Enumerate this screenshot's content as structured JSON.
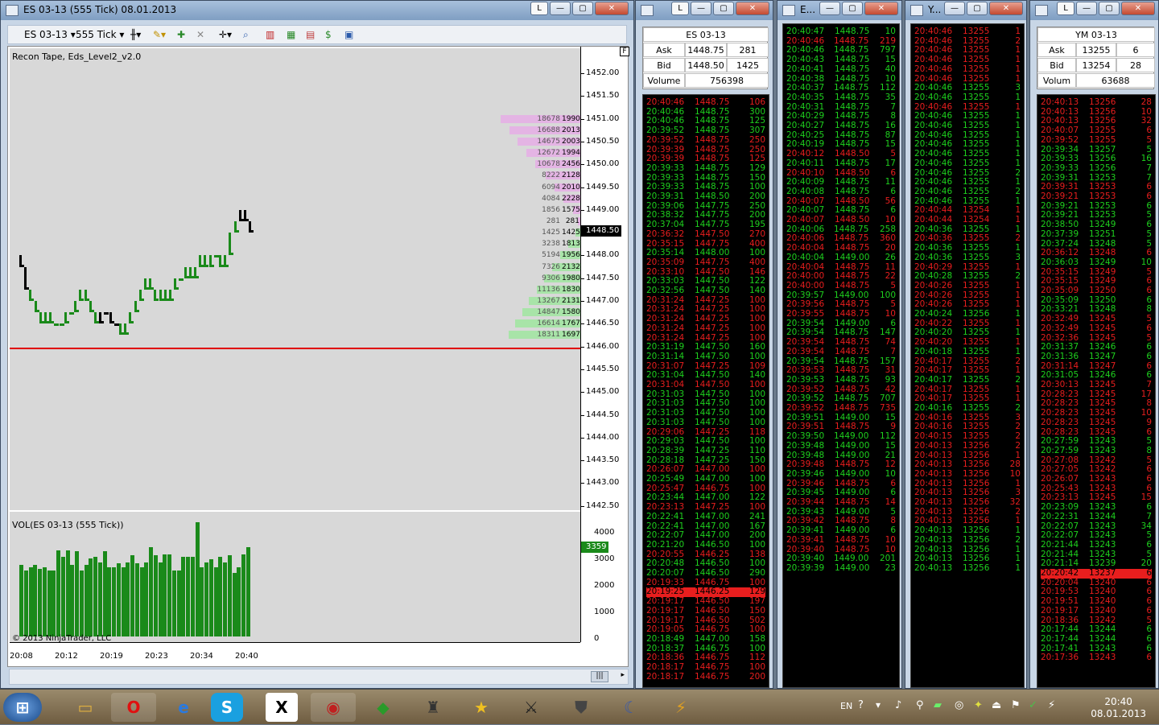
{
  "chart_window": {
    "title": "ES 03-13 (555 Tick)  08.01.2013",
    "instrument": "ES 03-13",
    "interval": "555 Tick",
    "indicator_label": "Recon Tape, Eds_Level2_v2.0",
    "copyright": "© 2013 NinjaTrader, LLC",
    "vol_label": "VOL(ES 03-13 (555 Tick))",
    "last_price": "1448.50",
    "last_vol": "3359",
    "corner_box": "F"
  },
  "price_axis": [
    "1452.00",
    "1451.50",
    "1451.00",
    "1450.50",
    "1450.00",
    "1449.50",
    "1449.00",
    "1448.50",
    "1448.00",
    "1447.50",
    "1447.00",
    "1446.50",
    "1446.00",
    "1445.50",
    "1445.00",
    "1444.50",
    "1444.00",
    "1443.50",
    "1443.00",
    "1442.50"
  ],
  "vol_axis": [
    "4000",
    "3000",
    "2000",
    "1000",
    "0"
  ],
  "time_axis": [
    "20:08",
    "20:12",
    "20:19",
    "20:23",
    "20:34",
    "20:40"
  ],
  "dom_ask": [
    [
      "18678",
      "1990"
    ],
    [
      "16688",
      "2013"
    ],
    [
      "14675",
      "2003"
    ],
    [
      "12672",
      "1994"
    ],
    [
      "10678",
      "2456"
    ],
    [
      "8222",
      "2128"
    ],
    [
      "6094",
      "2010"
    ],
    [
      "4084",
      "2228"
    ],
    [
      "1856",
      "1575"
    ],
    [
      "281",
      "281"
    ]
  ],
  "dom_bid": [
    [
      "1425",
      "1425"
    ],
    [
      "3238",
      "1813"
    ],
    [
      "5194",
      "1956"
    ],
    [
      "7326",
      "2132"
    ],
    [
      "9306",
      "1980"
    ],
    [
      "11136",
      "1830"
    ],
    [
      "13267",
      "2131"
    ],
    [
      "14847",
      "1580"
    ],
    [
      "16614",
      "1767"
    ],
    [
      "18311",
      "1697"
    ]
  ],
  "chart_data": {
    "type": "bar",
    "title": "",
    "xlabel": "",
    "ylabel": "",
    "ylim": [
      0,
      4600
    ],
    "values": [
      2700,
      2500,
      2600,
      2700,
      2550,
      2600,
      2500,
      2500,
      3250,
      3000,
      3250,
      2700,
      3200,
      2500,
      2700,
      2950,
      3000,
      2800,
      3200,
      2600,
      2600,
      2750,
      2600,
      2800,
      3050,
      2750,
      2600,
      2800,
      3350,
      3050,
      2800,
      3100,
      3100,
      2500,
      2500,
      3000,
      3000,
      3000,
      4300,
      2600,
      2800,
      2900,
      2600,
      3000,
      2800,
      3050,
      2400,
      2600,
      3100,
      3359
    ]
  },
  "quote_es": {
    "title": "ES 03-13",
    "ask_label": "Ask",
    "ask": "1448.75",
    "ask_size": "281",
    "bid_label": "Bid",
    "bid": "1448.50",
    "bid_size": "1425",
    "vol_label": "Volume",
    "vol": "756398"
  },
  "quote_ym": {
    "title": "YM 03-13",
    "ask_label": "Ask",
    "ask": "13255",
    "ask_size": "6",
    "bid_label": "Bid",
    "bid": "13254",
    "bid_size": "28",
    "vol_label": "Volum",
    "vol": "63688"
  },
  "tape1": [
    [
      "20:40:46",
      "1448.75",
      "106",
      "r"
    ],
    [
      "20:40:46",
      "1448.75",
      "300",
      "g"
    ],
    [
      "20:40:46",
      "1448.75",
      "125",
      "g"
    ],
    [
      "20:39:52",
      "1448.75",
      "307",
      "g"
    ],
    [
      "20:39:52",
      "1448.75",
      "250",
      "r"
    ],
    [
      "20:39:39",
      "1448.75",
      "250",
      "r"
    ],
    [
      "20:39:39",
      "1448.75",
      "125",
      "r"
    ],
    [
      "20:39:33",
      "1448.75",
      "129",
      "g"
    ],
    [
      "20:39:33",
      "1448.75",
      "150",
      "g"
    ],
    [
      "20:39:33",
      "1448.75",
      "100",
      "g"
    ],
    [
      "20:39:31",
      "1448.50",
      "200",
      "g"
    ],
    [
      "20:39:06",
      "1447.75",
      "250",
      "g"
    ],
    [
      "20:38:32",
      "1447.75",
      "200",
      "g"
    ],
    [
      "20:37:04",
      "1447.75",
      "195",
      "g"
    ],
    [
      "20:36:32",
      "1447.50",
      "270",
      "r"
    ],
    [
      "20:35:15",
      "1447.75",
      "400",
      "r"
    ],
    [
      "20:35:14",
      "1448.00",
      "100",
      "g"
    ],
    [
      "20:35:09",
      "1447.75",
      "400",
      "r"
    ],
    [
      "20:33:10",
      "1447.50",
      "146",
      "r"
    ],
    [
      "20:33:03",
      "1447.50",
      "122",
      "g"
    ],
    [
      "20:32:56",
      "1447.50",
      "140",
      "g"
    ],
    [
      "20:31:24",
      "1447.25",
      "100",
      "r"
    ],
    [
      "20:31:24",
      "1447.25",
      "100",
      "r"
    ],
    [
      "20:31:24",
      "1447.25",
      "100",
      "r"
    ],
    [
      "20:31:24",
      "1447.25",
      "100",
      "r"
    ],
    [
      "20:31:24",
      "1447.25",
      "100",
      "r"
    ],
    [
      "20:31:19",
      "1447.50",
      "160",
      "g"
    ],
    [
      "20:31:14",
      "1447.50",
      "100",
      "g"
    ],
    [
      "20:31:07",
      "1447.25",
      "109",
      "r"
    ],
    [
      "20:31:04",
      "1447.50",
      "140",
      "g"
    ],
    [
      "20:31:04",
      "1447.50",
      "100",
      "r"
    ],
    [
      "20:31:03",
      "1447.50",
      "100",
      "g"
    ],
    [
      "20:31:03",
      "1447.50",
      "100",
      "g"
    ],
    [
      "20:31:03",
      "1447.50",
      "100",
      "g"
    ],
    [
      "20:31:03",
      "1447.50",
      "100",
      "g"
    ],
    [
      "20:29:06",
      "1447.25",
      "118",
      "r"
    ],
    [
      "20:29:03",
      "1447.50",
      "100",
      "g"
    ],
    [
      "20:28:39",
      "1447.25",
      "110",
      "g"
    ],
    [
      "20:28:18",
      "1447.25",
      "150",
      "g"
    ],
    [
      "20:26:07",
      "1447.00",
      "100",
      "r"
    ],
    [
      "20:25:49",
      "1447.00",
      "100",
      "g"
    ],
    [
      "20:25:47",
      "1446.75",
      "100",
      "r"
    ],
    [
      "20:23:44",
      "1447.00",
      "122",
      "g"
    ],
    [
      "20:23:13",
      "1447.25",
      "100",
      "r"
    ],
    [
      "20:22:41",
      "1447.00",
      "241",
      "g"
    ],
    [
      "20:22:41",
      "1447.00",
      "167",
      "g"
    ],
    [
      "20:22:07",
      "1447.00",
      "200",
      "g"
    ],
    [
      "20:21:20",
      "1446.50",
      "100",
      "g"
    ],
    [
      "20:20:55",
      "1446.25",
      "138",
      "r"
    ],
    [
      "20:20:48",
      "1446.50",
      "100",
      "g"
    ],
    [
      "20:20:07",
      "1446.50",
      "290",
      "g"
    ],
    [
      "20:19:33",
      "1446.75",
      "100",
      "r"
    ],
    [
      "20:19:25",
      "1446.25",
      "129",
      "h"
    ],
    [
      "20:19:17",
      "1446.50",
      "197",
      "r"
    ],
    [
      "20:19:17",
      "1446.50",
      "150",
      "r"
    ],
    [
      "20:19:17",
      "1446.50",
      "502",
      "r"
    ],
    [
      "20:19:05",
      "1446.75",
      "100",
      "r"
    ],
    [
      "20:18:49",
      "1447.00",
      "158",
      "g"
    ],
    [
      "20:18:37",
      "1446.75",
      "100",
      "g"
    ],
    [
      "20:18:36",
      "1446.75",
      "112",
      "r"
    ],
    [
      "20:18:17",
      "1446.75",
      "100",
      "r"
    ],
    [
      "20:18:17",
      "1446.75",
      "200",
      "r"
    ]
  ],
  "tape2": [
    [
      "20:40:47",
      "1448.75",
      "10",
      "g"
    ],
    [
      "20:40:46",
      "1448.75",
      "219",
      "r"
    ],
    [
      "20:40:46",
      "1448.75",
      "797",
      "g"
    ],
    [
      "20:40:43",
      "1448.75",
      "15",
      "g"
    ],
    [
      "20:40:41",
      "1448.75",
      "40",
      "g"
    ],
    [
      "20:40:38",
      "1448.75",
      "10",
      "g"
    ],
    [
      "20:40:37",
      "1448.75",
      "112",
      "g"
    ],
    [
      "20:40:35",
      "1448.75",
      "35",
      "g"
    ],
    [
      "20:40:31",
      "1448.75",
      "7",
      "g"
    ],
    [
      "20:40:29",
      "1448.75",
      "8",
      "g"
    ],
    [
      "20:40:27",
      "1448.75",
      "16",
      "g"
    ],
    [
      "20:40:25",
      "1448.75",
      "87",
      "g"
    ],
    [
      "20:40:19",
      "1448.75",
      "15",
      "g"
    ],
    [
      "20:40:12",
      "1448.50",
      "5",
      "r"
    ],
    [
      "20:40:11",
      "1448.75",
      "17",
      "g"
    ],
    [
      "20:40:10",
      "1448.50",
      "6",
      "r"
    ],
    [
      "20:40:09",
      "1448.75",
      "11",
      "g"
    ],
    [
      "20:40:08",
      "1448.75",
      "6",
      "g"
    ],
    [
      "20:40:07",
      "1448.50",
      "56",
      "r"
    ],
    [
      "20:40:07",
      "1448.75",
      "6",
      "g"
    ],
    [
      "20:40:07",
      "1448.50",
      "10",
      "r"
    ],
    [
      "20:40:06",
      "1448.75",
      "258",
      "g"
    ],
    [
      "20:40:06",
      "1448.75",
      "360",
      "r"
    ],
    [
      "20:40:04",
      "1448.75",
      "20",
      "r"
    ],
    [
      "20:40:04",
      "1449.00",
      "26",
      "g"
    ],
    [
      "20:40:04",
      "1448.75",
      "11",
      "r"
    ],
    [
      "20:40:00",
      "1448.75",
      "22",
      "r"
    ],
    [
      "20:40:00",
      "1448.75",
      "5",
      "r"
    ],
    [
      "20:39:57",
      "1449.00",
      "100",
      "g"
    ],
    [
      "20:39:56",
      "1448.75",
      "5",
      "r"
    ],
    [
      "20:39:55",
      "1448.75",
      "10",
      "r"
    ],
    [
      "20:39:54",
      "1449.00",
      "6",
      "g"
    ],
    [
      "20:39:54",
      "1448.75",
      "147",
      "g"
    ],
    [
      "20:39:54",
      "1448.75",
      "74",
      "r"
    ],
    [
      "20:39:54",
      "1448.75",
      "7",
      "r"
    ],
    [
      "20:39:54",
      "1448.75",
      "157",
      "g"
    ],
    [
      "20:39:53",
      "1448.75",
      "31",
      "r"
    ],
    [
      "20:39:53",
      "1448.75",
      "93",
      "g"
    ],
    [
      "20:39:52",
      "1448.75",
      "42",
      "r"
    ],
    [
      "20:39:52",
      "1448.75",
      "707",
      "g"
    ],
    [
      "20:39:52",
      "1448.75",
      "735",
      "r"
    ],
    [
      "20:39:51",
      "1449.00",
      "15",
      "g"
    ],
    [
      "20:39:51",
      "1448.75",
      "9",
      "r"
    ],
    [
      "20:39:50",
      "1449.00",
      "112",
      "g"
    ],
    [
      "20:39:48",
      "1449.00",
      "15",
      "g"
    ],
    [
      "20:39:48",
      "1449.00",
      "21",
      "g"
    ],
    [
      "20:39:48",
      "1448.75",
      "12",
      "r"
    ],
    [
      "20:39:46",
      "1449.00",
      "10",
      "g"
    ],
    [
      "20:39:46",
      "1448.75",
      "6",
      "r"
    ],
    [
      "20:39:45",
      "1449.00",
      "6",
      "g"
    ],
    [
      "20:39:44",
      "1448.75",
      "14",
      "r"
    ],
    [
      "20:39:43",
      "1449.00",
      "5",
      "g"
    ],
    [
      "20:39:42",
      "1448.75",
      "8",
      "r"
    ],
    [
      "20:39:41",
      "1449.00",
      "6",
      "g"
    ],
    [
      "20:39:41",
      "1448.75",
      "10",
      "r"
    ],
    [
      "20:39:40",
      "1448.75",
      "10",
      "r"
    ],
    [
      "20:39:40",
      "1449.00",
      "201",
      "g"
    ],
    [
      "20:39:39",
      "1449.00",
      "23",
      "g"
    ]
  ],
  "tape3": [
    [
      "20:40:46",
      "13255",
      "1",
      "r"
    ],
    [
      "20:40:46",
      "13255",
      "2",
      "r"
    ],
    [
      "20:40:46",
      "13255",
      "1",
      "r"
    ],
    [
      "20:40:46",
      "13255",
      "1",
      "r"
    ],
    [
      "20:40:46",
      "13255",
      "1",
      "r"
    ],
    [
      "20:40:46",
      "13255",
      "1",
      "r"
    ],
    [
      "20:40:46",
      "13255",
      "3",
      "g"
    ],
    [
      "20:40:46",
      "13255",
      "1",
      "g"
    ],
    [
      "20:40:46",
      "13255",
      "1",
      "r"
    ],
    [
      "20:40:46",
      "13255",
      "1",
      "g"
    ],
    [
      "20:40:46",
      "13255",
      "1",
      "g"
    ],
    [
      "20:40:46",
      "13255",
      "1",
      "g"
    ],
    [
      "20:40:46",
      "13255",
      "1",
      "g"
    ],
    [
      "20:40:46",
      "13255",
      "1",
      "g"
    ],
    [
      "20:40:46",
      "13255",
      "1",
      "g"
    ],
    [
      "20:40:46",
      "13255",
      "2",
      "g"
    ],
    [
      "20:40:46",
      "13255",
      "1",
      "g"
    ],
    [
      "20:40:46",
      "13255",
      "2",
      "g"
    ],
    [
      "20:40:46",
      "13255",
      "1",
      "g"
    ],
    [
      "20:40:44",
      "13254",
      "1",
      "r"
    ],
    [
      "20:40:44",
      "13254",
      "1",
      "r"
    ],
    [
      "20:40:36",
      "13255",
      "1",
      "g"
    ],
    [
      "20:40:36",
      "13255",
      "2",
      "r"
    ],
    [
      "20:40:36",
      "13255",
      "1",
      "g"
    ],
    [
      "20:40:36",
      "13255",
      "3",
      "g"
    ],
    [
      "20:40:29",
      "13255",
      "1",
      "r"
    ],
    [
      "20:40:28",
      "13255",
      "2",
      "g"
    ],
    [
      "20:40:26",
      "13255",
      "1",
      "r"
    ],
    [
      "20:40:26",
      "13255",
      "1",
      "r"
    ],
    [
      "20:40:26",
      "13255",
      "1",
      "r"
    ],
    [
      "20:40:24",
      "13256",
      "1",
      "g"
    ],
    [
      "20:40:22",
      "13255",
      "1",
      "r"
    ],
    [
      "20:40:20",
      "13255",
      "1",
      "g"
    ],
    [
      "20:40:20",
      "13255",
      "1",
      "r"
    ],
    [
      "20:40:18",
      "13255",
      "1",
      "g"
    ],
    [
      "20:40:17",
      "13255",
      "2",
      "r"
    ],
    [
      "20:40:17",
      "13255",
      "1",
      "r"
    ],
    [
      "20:40:17",
      "13255",
      "2",
      "g"
    ],
    [
      "20:40:17",
      "13255",
      "1",
      "r"
    ],
    [
      "20:40:17",
      "13255",
      "1",
      "r"
    ],
    [
      "20:40:16",
      "13255",
      "2",
      "g"
    ],
    [
      "20:40:16",
      "13255",
      "3",
      "r"
    ],
    [
      "20:40:16",
      "13255",
      "2",
      "r"
    ],
    [
      "20:40:15",
      "13255",
      "2",
      "r"
    ],
    [
      "20:40:13",
      "13256",
      "2",
      "r"
    ],
    [
      "20:40:13",
      "13256",
      "1",
      "r"
    ],
    [
      "20:40:13",
      "13256",
      "28",
      "r"
    ],
    [
      "20:40:13",
      "13256",
      "10",
      "r"
    ],
    [
      "20:40:13",
      "13256",
      "1",
      "r"
    ],
    [
      "20:40:13",
      "13256",
      "3",
      "r"
    ],
    [
      "20:40:13",
      "13256",
      "32",
      "r"
    ],
    [
      "20:40:13",
      "13256",
      "2",
      "r"
    ],
    [
      "20:40:13",
      "13256",
      "1",
      "r"
    ],
    [
      "20:40:13",
      "13256",
      "1",
      "g"
    ],
    [
      "20:40:13",
      "13256",
      "2",
      "g"
    ],
    [
      "20:40:13",
      "13256",
      "1",
      "g"
    ],
    [
      "20:40:13",
      "13256",
      "1",
      "g"
    ],
    [
      "20:40:13",
      "13256",
      "1",
      "g"
    ]
  ],
  "tape4": [
    [
      "20:40:13",
      "13256",
      "28",
      "r"
    ],
    [
      "20:40:13",
      "13256",
      "10",
      "r"
    ],
    [
      "20:40:13",
      "13256",
      "32",
      "r"
    ],
    [
      "20:40:07",
      "13255",
      "6",
      "r"
    ],
    [
      "20:39:52",
      "13255",
      "5",
      "r"
    ],
    [
      "20:39:34",
      "13257",
      "5",
      "g"
    ],
    [
      "20:39:33",
      "13256",
      "16",
      "g"
    ],
    [
      "20:39:33",
      "13256",
      "7",
      "g"
    ],
    [
      "20:39:31",
      "13253",
      "7",
      "g"
    ],
    [
      "20:39:31",
      "13253",
      "6",
      "r"
    ],
    [
      "20:39:21",
      "13253",
      "6",
      "r"
    ],
    [
      "20:39:21",
      "13253",
      "6",
      "g"
    ],
    [
      "20:39:21",
      "13253",
      "5",
      "g"
    ],
    [
      "20:38:50",
      "13249",
      "6",
      "g"
    ],
    [
      "20:37:39",
      "13251",
      "5",
      "g"
    ],
    [
      "20:37:24",
      "13248",
      "5",
      "g"
    ],
    [
      "20:36:12",
      "13248",
      "6",
      "r"
    ],
    [
      "20:36:03",
      "13249",
      "10",
      "g"
    ],
    [
      "20:35:15",
      "13249",
      "5",
      "r"
    ],
    [
      "20:35:15",
      "13249",
      "6",
      "r"
    ],
    [
      "20:35:09",
      "13250",
      "6",
      "r"
    ],
    [
      "20:35:09",
      "13250",
      "6",
      "g"
    ],
    [
      "20:33:21",
      "13248",
      "8",
      "g"
    ],
    [
      "20:32:49",
      "13245",
      "5",
      "r"
    ],
    [
      "20:32:49",
      "13245",
      "6",
      "r"
    ],
    [
      "20:32:36",
      "13245",
      "5",
      "r"
    ],
    [
      "20:31:37",
      "13246",
      "6",
      "g"
    ],
    [
      "20:31:36",
      "13247",
      "6",
      "g"
    ],
    [
      "20:31:14",
      "13247",
      "6",
      "r"
    ],
    [
      "20:31:05",
      "13246",
      "6",
      "g"
    ],
    [
      "20:30:13",
      "13245",
      "7",
      "r"
    ],
    [
      "20:28:23",
      "13245",
      "17",
      "r"
    ],
    [
      "20:28:23",
      "13245",
      "8",
      "r"
    ],
    [
      "20:28:23",
      "13245",
      "10",
      "r"
    ],
    [
      "20:28:23",
      "13245",
      "9",
      "r"
    ],
    [
      "20:28:23",
      "13245",
      "6",
      "r"
    ],
    [
      "20:27:59",
      "13243",
      "5",
      "g"
    ],
    [
      "20:27:59",
      "13243",
      "8",
      "g"
    ],
    [
      "20:27:08",
      "13242",
      "5",
      "r"
    ],
    [
      "20:27:05",
      "13242",
      "6",
      "r"
    ],
    [
      "20:26:07",
      "13243",
      "6",
      "r"
    ],
    [
      "20:25:43",
      "13243",
      "6",
      "r"
    ],
    [
      "20:23:13",
      "13245",
      "15",
      "r"
    ],
    [
      "20:23:09",
      "13243",
      "6",
      "g"
    ],
    [
      "20:22:31",
      "13244",
      "7",
      "g"
    ],
    [
      "20:22:07",
      "13243",
      "34",
      "g"
    ],
    [
      "20:22:07",
      "13243",
      "5",
      "g"
    ],
    [
      "20:21:44",
      "13243",
      "6",
      "g"
    ],
    [
      "20:21:44",
      "13243",
      "5",
      "g"
    ],
    [
      "20:21:14",
      "13239",
      "20",
      "g"
    ],
    [
      "20:20:42",
      "13237",
      "6",
      "h"
    ],
    [
      "20:20:04",
      "13240",
      "6",
      "r"
    ],
    [
      "20:19:53",
      "13240",
      "6",
      "r"
    ],
    [
      "20:19:51",
      "13240",
      "6",
      "r"
    ],
    [
      "20:19:17",
      "13240",
      "6",
      "r"
    ],
    [
      "20:18:36",
      "13242",
      "5",
      "r"
    ],
    [
      "20:17:44",
      "13244",
      "6",
      "g"
    ],
    [
      "20:17:44",
      "13244",
      "6",
      "g"
    ],
    [
      "20:17:41",
      "13243",
      "6",
      "g"
    ],
    [
      "20:17:36",
      "13243",
      "6",
      "r"
    ]
  ],
  "panel_titles": {
    "p2": "E...",
    "p3": "Y..."
  },
  "taskbar": {
    "lang": "EN",
    "time": "20:40",
    "date": "08.01.2013"
  }
}
